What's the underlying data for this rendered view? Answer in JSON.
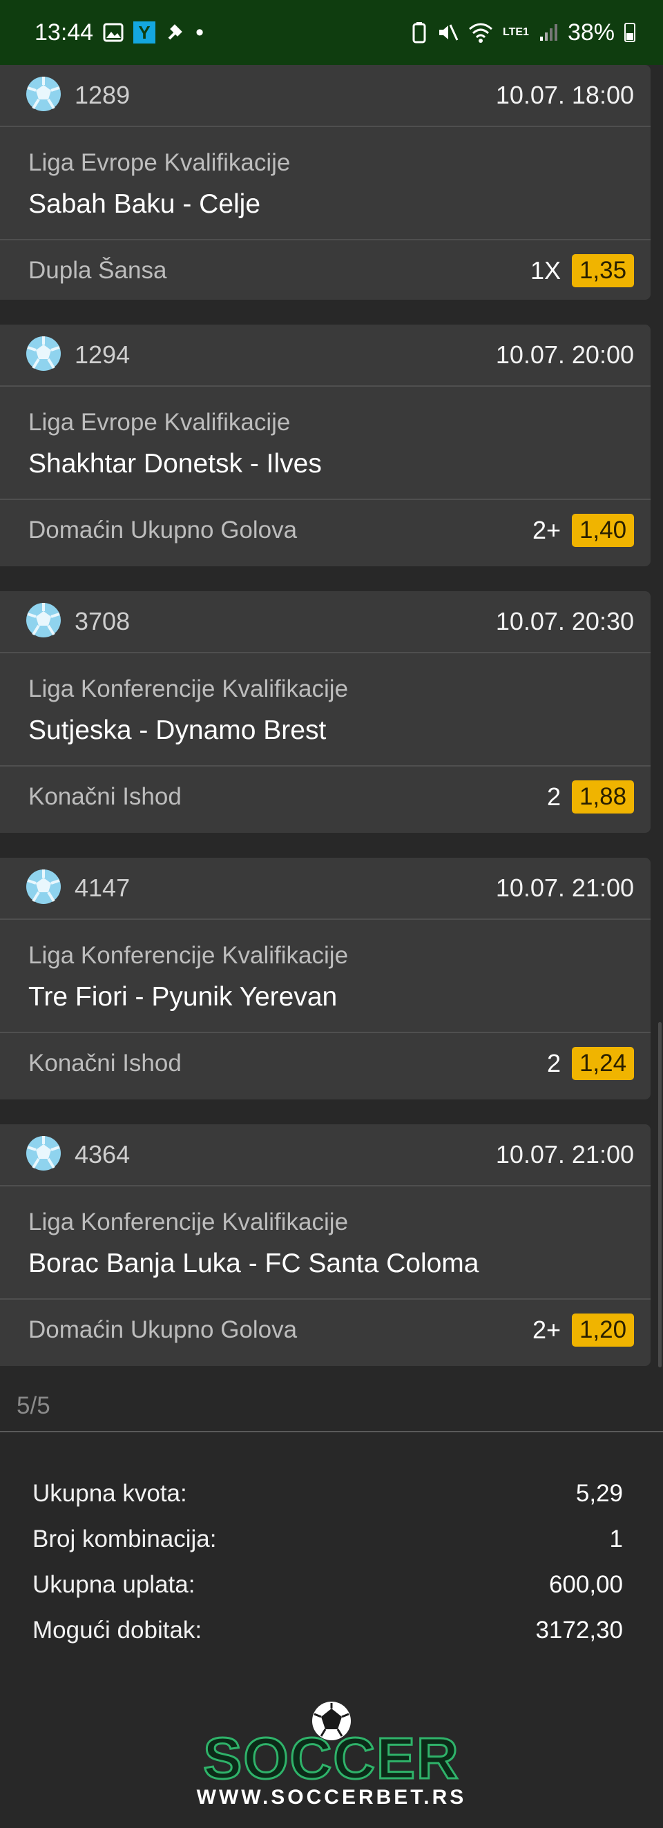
{
  "status_bar": {
    "time": "13:44",
    "y_badge": "Y",
    "dot": "•",
    "network": "LTE1",
    "battery": "38%"
  },
  "matches": [
    {
      "id": "1289",
      "time": "10.07. 18:00",
      "league": "Liga Evrope Kvalifikacije",
      "teams": "Sabah Baku - Celje",
      "market": "Dupla Šansa",
      "pick": "1X",
      "odds": "1,35"
    },
    {
      "id": "1294",
      "time": "10.07. 20:00",
      "league": "Liga Evrope Kvalifikacije",
      "teams": "Shakhtar Donetsk - Ilves",
      "market": "Domaćin Ukupno Golova",
      "pick": "2+",
      "odds": "1,40"
    },
    {
      "id": "3708",
      "time": "10.07. 20:30",
      "league": "Liga Konferencije Kvalifikacije",
      "teams": "Sutjeska - Dynamo Brest",
      "market": "Konačni Ishod",
      "pick": "2",
      "odds": "1,88"
    },
    {
      "id": "4147",
      "time": "10.07. 21:00",
      "league": "Liga Konferencije Kvalifikacije",
      "teams": "Tre Fiori - Pyunik Yerevan",
      "market": "Konačni Ishod",
      "pick": "2",
      "odds": "1,24"
    },
    {
      "id": "4364",
      "time": "10.07. 21:00",
      "league": "Liga Konferencije Kvalifikacije",
      "teams": "Borac Banja Luka - FC Santa Coloma",
      "market": "Domaćin Ukupno Golova",
      "pick": "2+",
      "odds": "1,20"
    }
  ],
  "pager": "5/5",
  "summary": {
    "total_odds_label": "Ukupna kvota:",
    "total_odds": "5,29",
    "combos_label": "Broj kombinacija:",
    "combos": "1",
    "stake_label": "Ukupna uplata:",
    "stake": "600,00",
    "win_label": "Mogući dobitak:",
    "win": "3172,30"
  },
  "logo": {
    "brand": "SOCCER",
    "url": "WWW.SOCCERBET.RS"
  },
  "colors": {
    "status_bar": "#0f3d0f",
    "card": "#3a3a3a",
    "background": "#282828",
    "odds_badge": "#f0b400"
  }
}
